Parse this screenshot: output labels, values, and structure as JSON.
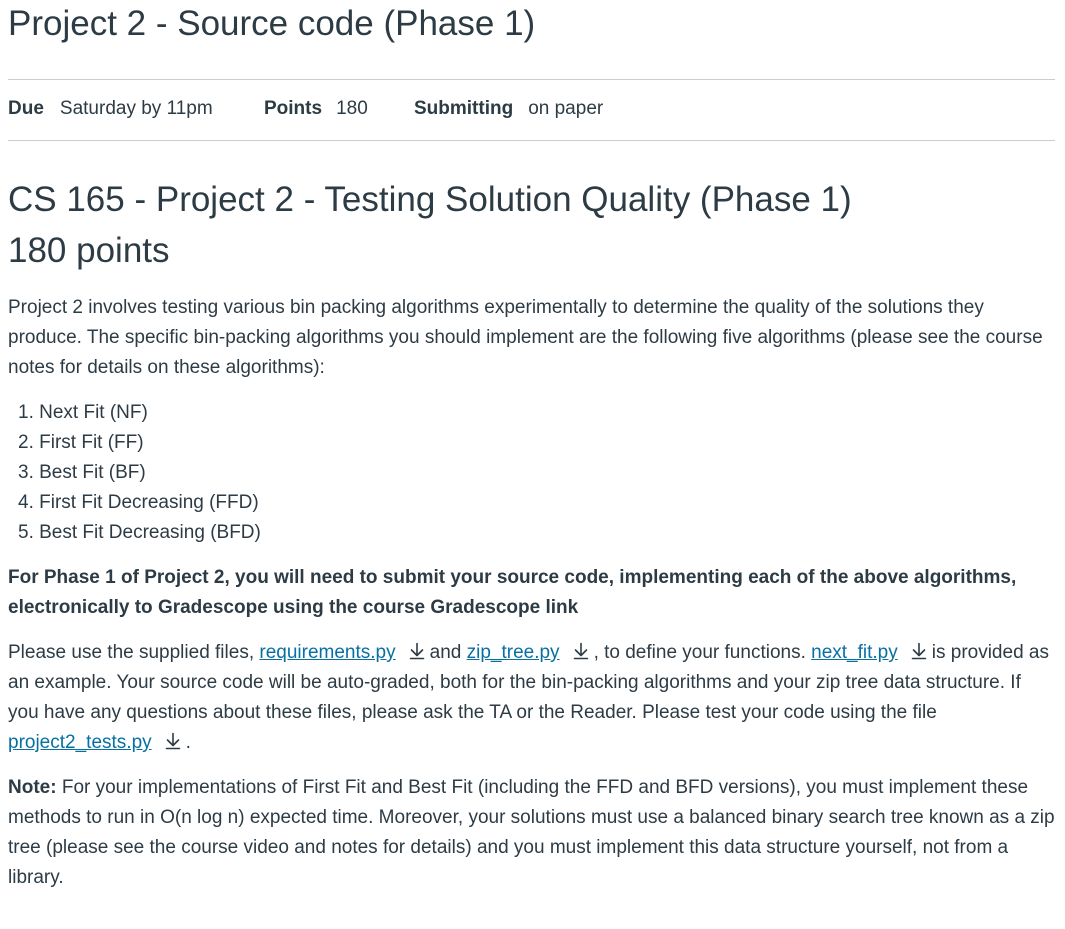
{
  "header": {
    "title": "Project 2 - Source code (Phase 1)"
  },
  "meta": {
    "due_label": "Due",
    "due_value": "Saturday by 11pm",
    "points_label": "Points",
    "points_value": "180",
    "submitting_label": "Submitting",
    "submitting_value": "on paper"
  },
  "content": {
    "title": "CS 165 - Project 2 - Testing Solution Quality (Phase 1)",
    "subtitle": "180 points",
    "intro": "Project 2 involves testing various bin packing algorithms experimentally to determine the quality of the solutions they produce. The specific bin-packing algorithms you should implement are the following five algorithms (please see the course notes for details on these algorithms):",
    "algorithms": [
      "1. Next Fit (NF)",
      "2. First Fit (FF)",
      "3. Best Fit (BF)",
      "4. First Fit Decreasing (FFD)",
      "5. Best Fit Decreasing (BFD)"
    ],
    "phase_instruction": "For Phase 1 of Project 2, you will need to submit your source code, implementing each of the above algorithms, electronically to Gradescope using the course Gradescope link",
    "files_paragraph": {
      "text_1": "Please use the supplied files, ",
      "link_1": "requirements.py",
      "text_2": "and ",
      "link_2": "zip_tree.py",
      "text_3": ", to define your functions. ",
      "link_3": "next_fit.py",
      "text_4": "is provided as an example. Your source code will be auto-graded, both for the bin-packing algorithms and your zip tree data structure. If you have any questions about these files, please ask the TA or the Reader. Please test your code using the file ",
      "link_4": "project2_tests.py",
      "text_5": "."
    },
    "note": {
      "label": "Note:",
      "text": " For your implementations of First Fit and Best Fit (including the FFD and BFD versions), you must implement these methods to run in O(n log n) expected time. Moreover, your solutions must use a balanced binary search tree known as a zip tree (please see the course video and notes for details) and you must implement this data structure yourself, not from a library."
    }
  },
  "colors": {
    "text": "#2d3b45",
    "link": "#0770a3",
    "rule": "#c7cdd1"
  },
  "icons": {
    "download": "download-icon"
  }
}
